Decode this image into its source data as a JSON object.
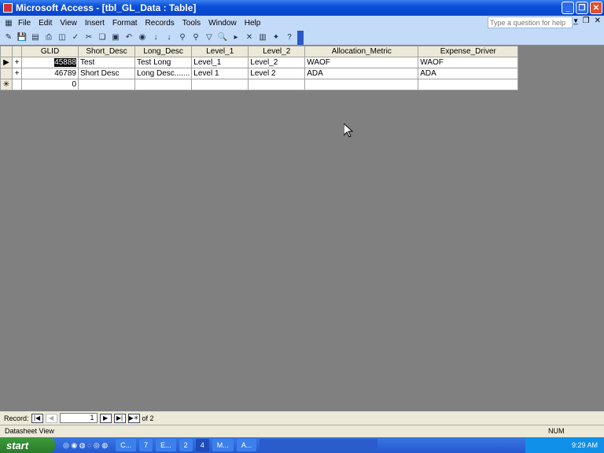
{
  "window": {
    "title": "Microsoft Access - [tbl_GL_Data : Table]"
  },
  "menu": [
    "File",
    "Edit",
    "View",
    "Insert",
    "Format",
    "Records",
    "Tools",
    "Window",
    "Help"
  ],
  "help": {
    "placeholder": "Type a question for help"
  },
  "table": {
    "columns": [
      "GLID",
      "Short_Desc",
      "Long_Desc",
      "Level_1",
      "Level_2",
      "Allocation_Metric",
      "Expense_Driver"
    ],
    "rows": [
      [
        "45888",
        "Test",
        "Test Long",
        "Level_1",
        "Level_2",
        "WAOF",
        "WAOF"
      ],
      [
        "46789",
        "Short Desc",
        "Long Desc.......",
        "Level 1",
        "Level 2",
        "ADA",
        "ADA"
      ]
    ],
    "new_row_glid": "0"
  },
  "record_nav": {
    "label": "Record:",
    "current": "1",
    "of": "of  2"
  },
  "status": {
    "view": "Datasheet View",
    "num": "NUM"
  },
  "taskbar": {
    "start": "start",
    "tasks": [
      "C...",
      "7",
      "E...",
      "2",
      "4",
      "M...",
      "A..."
    ],
    "clock": "9:29 AM"
  }
}
